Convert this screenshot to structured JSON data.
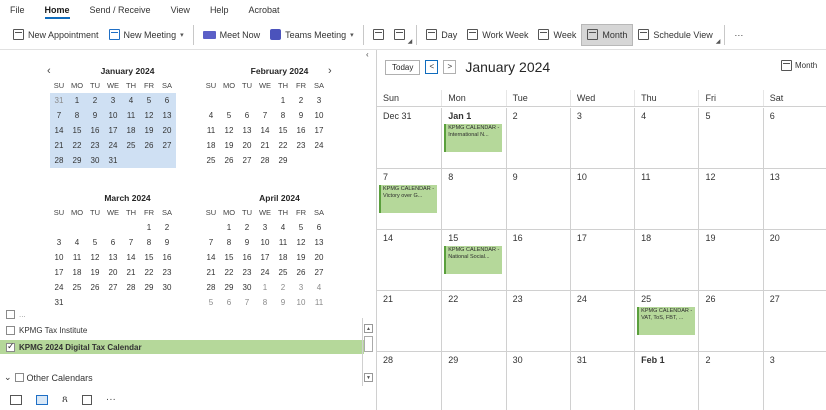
{
  "menu": {
    "tabs": [
      "File",
      "Home",
      "Send / Receive",
      "View",
      "Help",
      "Acrobat"
    ],
    "active": "Home"
  },
  "ribbon": {
    "new_appointment": "New Appointment",
    "new_meeting": "New Meeting",
    "meet_now": "Meet Now",
    "teams_meeting": "Teams Meeting",
    "day": "Day",
    "work_week": "Work Week",
    "week": "Week",
    "month": "Month",
    "schedule_view": "Schedule View",
    "more": "···"
  },
  "minicals": [
    {
      "title": "January 2024",
      "dow": [
        "SU",
        "MO",
        "TU",
        "WE",
        "TH",
        "FR",
        "SA"
      ],
      "rows": [
        [
          "31",
          "1",
          "2",
          "3",
          "4",
          "5",
          "6"
        ],
        [
          "7",
          "8",
          "9",
          "10",
          "11",
          "12",
          "13"
        ],
        [
          "14",
          "15",
          "16",
          "17",
          "18",
          "19",
          "20"
        ],
        [
          "21",
          "22",
          "23",
          "24",
          "25",
          "26",
          "27"
        ],
        [
          "28",
          "29",
          "30",
          "31",
          "",
          "",
          ""
        ]
      ]
    },
    {
      "title": "February 2024",
      "dow": [
        "SU",
        "MO",
        "TU",
        "WE",
        "TH",
        "FR",
        "SA"
      ],
      "rows": [
        [
          "",
          "",
          "",
          "",
          "1",
          "2",
          "3"
        ],
        [
          "4",
          "5",
          "6",
          "7",
          "8",
          "9",
          "10"
        ],
        [
          "11",
          "12",
          "13",
          "14",
          "15",
          "16",
          "17"
        ],
        [
          "18",
          "19",
          "20",
          "21",
          "22",
          "23",
          "24"
        ],
        [
          "25",
          "26",
          "27",
          "28",
          "29",
          "",
          ""
        ]
      ]
    },
    {
      "title": "March 2024",
      "dow": [
        "SU",
        "MO",
        "TU",
        "WE",
        "TH",
        "FR",
        "SA"
      ],
      "rows": [
        [
          "",
          "",
          "",
          "",
          "",
          "1",
          "2"
        ],
        [
          "3",
          "4",
          "5",
          "6",
          "7",
          "8",
          "9"
        ],
        [
          "10",
          "11",
          "12",
          "13",
          "14",
          "15",
          "16"
        ],
        [
          "17",
          "18",
          "19",
          "20",
          "21",
          "22",
          "23"
        ],
        [
          "24",
          "25",
          "26",
          "27",
          "28",
          "29",
          "30"
        ],
        [
          "31",
          "",
          "",
          "",
          "",
          "",
          ""
        ]
      ]
    },
    {
      "title": "April 2024",
      "dow": [
        "SU",
        "MO",
        "TU",
        "WE",
        "TH",
        "FR",
        "SA"
      ],
      "rows": [
        [
          "",
          "1",
          "2",
          "3",
          "4",
          "5",
          "6"
        ],
        [
          "7",
          "8",
          "9",
          "10",
          "11",
          "12",
          "13"
        ],
        [
          "14",
          "15",
          "16",
          "17",
          "18",
          "19",
          "20"
        ],
        [
          "21",
          "22",
          "23",
          "24",
          "25",
          "26",
          "27"
        ],
        [
          "28",
          "29",
          "30",
          "1",
          "2",
          "3",
          "4"
        ],
        [
          "5",
          "6",
          "7",
          "8",
          "9",
          "10",
          "11"
        ]
      ]
    }
  ],
  "calendars": {
    "partial_item": "...",
    "tax_institute": "KPMG Tax Institute",
    "digital_tax": "KPMG 2024 Digital Tax Calendar",
    "other": "Other Calendars"
  },
  "bottom_nav": {
    "more": "···"
  },
  "calendar": {
    "today": "Today",
    "title": "January 2024",
    "view_selector": "Month",
    "day_headers": [
      "Sun",
      "Mon",
      "Tue",
      "Wed",
      "Thu",
      "Fri",
      "Sat"
    ],
    "weeks": [
      [
        "Dec 31",
        "Jan 1",
        "2",
        "3",
        "4",
        "5",
        "6"
      ],
      [
        "7",
        "8",
        "9",
        "10",
        "11",
        "12",
        "13"
      ],
      [
        "14",
        "15",
        "16",
        "17",
        "18",
        "19",
        "20"
      ],
      [
        "21",
        "22",
        "23",
        "24",
        "25",
        "26",
        "27"
      ],
      [
        "28",
        "29",
        "30",
        "31",
        "Feb 1",
        "2",
        "3"
      ]
    ],
    "events": [
      {
        "week": 0,
        "day": 1,
        "text": "KPMG CALENDAR - International N..."
      },
      {
        "week": 1,
        "day": 0,
        "text": "KPMG CALENDAR - Victory over G..."
      },
      {
        "week": 2,
        "day": 1,
        "text": "KPMG CALENDAR - National Social..."
      },
      {
        "week": 3,
        "day": 4,
        "text": "KPMG CALENDAR - VAT, ToS, FBT, ..."
      }
    ]
  }
}
